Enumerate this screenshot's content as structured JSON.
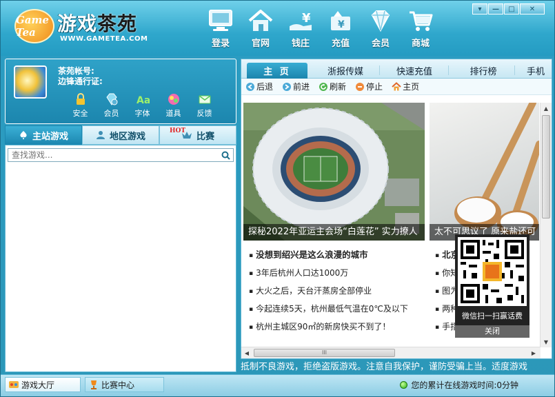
{
  "app": {
    "logo_badge": "Game Tea",
    "logo_title_a": "游戏",
    "logo_title_b": "茶苑",
    "logo_url": "WWW.GAMETEA.COM"
  },
  "nav": [
    {
      "label": "登录",
      "icon": "computer-icon"
    },
    {
      "label": "官网",
      "icon": "home-icon"
    },
    {
      "label": "钱庄",
      "icon": "yen-bank-icon"
    },
    {
      "label": "充值",
      "icon": "recharge-icon"
    },
    {
      "label": "会员",
      "icon": "diamond-icon"
    },
    {
      "label": "商城",
      "icon": "shopping-cart-icon"
    }
  ],
  "window_controls": {
    "menu": "▾",
    "minimize": "—",
    "maximize": "□",
    "close": "✕"
  },
  "profile": {
    "account_label": "茶苑帐号:",
    "pass_label": "边锋通行证:",
    "tools": [
      {
        "label": "安全",
        "icon": "lock-icon"
      },
      {
        "label": "会员",
        "icon": "member-icon"
      },
      {
        "label": "字体",
        "icon": "font-icon"
      },
      {
        "label": "道具",
        "icon": "gift-icon"
      },
      {
        "label": "反馈",
        "icon": "feedback-icon"
      }
    ]
  },
  "left_tabs": [
    {
      "label": "主站游戏",
      "active": true
    },
    {
      "label": "地区游戏",
      "active": false
    },
    {
      "label": "比赛",
      "active": false,
      "badge": "HOT"
    }
  ],
  "search": {
    "placeholder": "查找游戏..."
  },
  "right_tabs": [
    {
      "label": "主 页",
      "active": true
    },
    {
      "label": "浙报传媒",
      "active": false
    },
    {
      "label": "快速充值",
      "active": false
    },
    {
      "label": "排行榜",
      "active": false
    },
    {
      "label": "手机",
      "active": false
    }
  ],
  "browser_toolbar": [
    {
      "label": "后退",
      "icon": "back-arrow-icon"
    },
    {
      "label": "前进",
      "icon": "forward-arrow-icon"
    },
    {
      "label": "刷新",
      "icon": "refresh-icon"
    },
    {
      "label": "停止",
      "icon": "stop-icon"
    },
    {
      "label": "主页",
      "icon": "home-icon"
    }
  ],
  "news": {
    "feature1_caption": "探秘2022年亚运主会场“白莲花” 实力撩人",
    "feature2_caption": "太不可思议了 原来盐还可",
    "list1": [
      {
        "text": "没想到绍兴是这么浪漫的城市",
        "bold": true
      },
      {
        "text": "3年后杭州人口达1000万",
        "bold": false
      },
      {
        "text": "大火之后，天台汗蒸房全部停业",
        "bold": false
      },
      {
        "text": "今起连续5天，杭州最低气温在0℃及以下",
        "bold": false
      },
      {
        "text": "杭州主城区90㎡的新房快买不到了！",
        "bold": false
      }
    ],
    "list2": [
      {
        "text": "北京",
        "bold": true
      },
      {
        "text": "你知",
        "bold": false
      },
      {
        "text": "图为",
        "bold": false
      },
      {
        "text": "两种",
        "bold": false
      },
      {
        "text": "手指",
        "bold": false
      }
    ]
  },
  "qr_popup": {
    "text": "微信扫一扫赢话费",
    "close": "关闭"
  },
  "notice": "抵制不良游戏，拒绝盗版游戏。注意自我保护，谨防受骗上当。适度游戏",
  "statusbar": {
    "tab1": "游戏大厅",
    "tab2": "比赛中心",
    "online_text": "您的累计在线游戏时间:0分钟"
  }
}
